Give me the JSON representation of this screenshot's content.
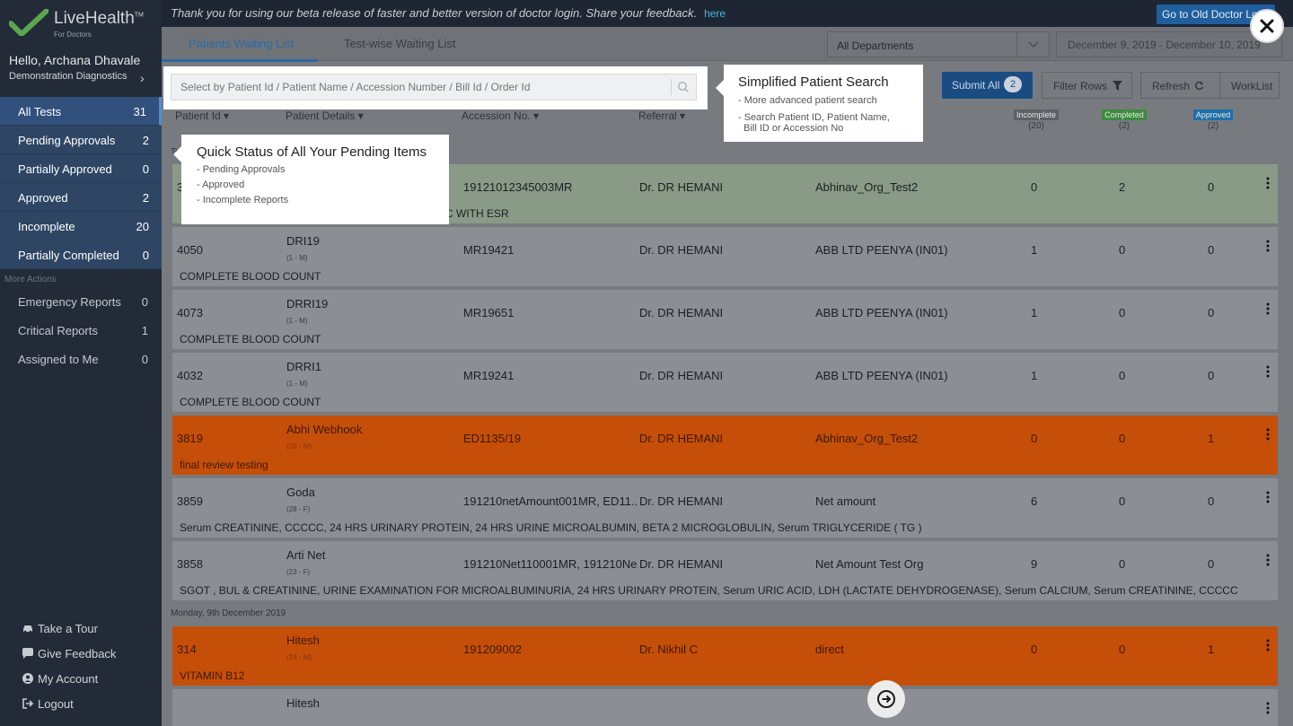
{
  "brand": {
    "name": "LiveHealth",
    "tagline": "For Doctors",
    "tm": "TM"
  },
  "user": {
    "greeting": "Hello, Archana Dhavale",
    "org": "Demonstration Diagnostics"
  },
  "nav": [
    {
      "label": "All Tests",
      "count": "31"
    },
    {
      "label": "Pending Approvals",
      "count": "2"
    },
    {
      "label": "Partially Approved",
      "count": "0"
    },
    {
      "label": "Approved",
      "count": "2"
    },
    {
      "label": "Incomplete",
      "count": "20"
    },
    {
      "label": "Partially Completed",
      "count": "0"
    }
  ],
  "more_actions_label": "More Actions",
  "more_nav": [
    {
      "label": "Emergency Reports",
      "count": "0"
    },
    {
      "label": "Critical Reports",
      "count": "1"
    },
    {
      "label": "Assigned to Me",
      "count": "0"
    }
  ],
  "bottom_links": [
    {
      "label": "Take a Tour",
      "icon": "car-icon"
    },
    {
      "label": "Give Feedback",
      "icon": "chat-icon"
    },
    {
      "label": "My Account",
      "icon": "user-circle-icon"
    },
    {
      "label": "Logout",
      "icon": "logout-icon"
    }
  ],
  "banner": {
    "text": "Thank you for using our beta release of faster and better version of doctor login. Share your feedback.",
    "link": "here",
    "old_login": "Go to Old Doctor Login"
  },
  "tabs": [
    "Patients Waiting List",
    "Test-wise Waiting List"
  ],
  "department": "All Departments",
  "date_range": "December 9, 2019 - December 10, 2019",
  "search": {
    "placeholder": "Select by Patient Id / Patient Name / Accession Number / Bill Id / Order Id"
  },
  "toolbar": {
    "submit": "Submit All",
    "submit_count": "2",
    "filter": "Filter Rows",
    "refresh": "Refresh",
    "worklist": "WorkList"
  },
  "columns": {
    "patient_id": "Patient Id",
    "patient_details": "Patient Details",
    "accession": "Accession No.",
    "referral": "Referral"
  },
  "stats": {
    "incomplete": {
      "label": "Incomplete",
      "count": "(20)"
    },
    "completed": {
      "label": "Completed",
      "count": "(2)"
    },
    "approved": {
      "label": "Approved",
      "count": "(2)"
    }
  },
  "rows": [
    {
      "id": "3",
      "name": "",
      "age": "",
      "accession": "19121012345003MR",
      "referral": "Dr. DR HEMANI",
      "org": "Abhinav_Org_Test2",
      "inc": "0",
      "comp": "2",
      "appr": "0",
      "tests": "BC WITH ESR",
      "style": "green"
    },
    {
      "id": "4050",
      "name": "DRI19",
      "age": "(1 - M)",
      "accession": "MR19421",
      "referral": "Dr. DR HEMANI",
      "org": "ABB LTD PEENYA (IN01)",
      "inc": "1",
      "comp": "0",
      "appr": "0",
      "tests": "COMPLETE BLOOD COUNT",
      "style": "grey"
    },
    {
      "id": "4073",
      "name": "DRRI19",
      "age": "(1 - M)",
      "accession": "MR19651",
      "referral": "Dr. DR HEMANI",
      "org": "ABB LTD PEENYA (IN01)",
      "inc": "1",
      "comp": "0",
      "appr": "0",
      "tests": "COMPLETE BLOOD COUNT",
      "style": "grey"
    },
    {
      "id": "4032",
      "name": "DRRI1",
      "age": "(1 - M)",
      "accession": "MR19241",
      "referral": "Dr. DR HEMANI",
      "org": "ABB LTD PEENYA (IN01)",
      "inc": "1",
      "comp": "0",
      "appr": "0",
      "tests": "COMPLETE BLOOD COUNT",
      "style": "grey"
    },
    {
      "id": "3819",
      "name": "Abhi Webhook",
      "age": "(20 - M)",
      "accession": "ED1135/19",
      "referral": "Dr. DR HEMANI",
      "org": "Abhinav_Org_Test2",
      "inc": "0",
      "comp": "0",
      "appr": "1",
      "tests": "final review testing",
      "style": "orange"
    },
    {
      "id": "3859",
      "name": "Goda",
      "age": "(28 - F)",
      "accession": "191210netAmount001MR, ED11...",
      "referral": "Dr. DR HEMANI",
      "org": "Net amount",
      "inc": "6",
      "comp": "0",
      "appr": "0",
      "tests": "Serum CREATININE, CCCCC, 24 HRS URINARY PROTEIN, 24 HRS URINE MICROALBUMIN, BETA 2 MICROGLOBULIN, Serum TRIGLYCERIDE ( TG )",
      "style": "grey"
    },
    {
      "id": "3858",
      "name": "Arti Net",
      "age": "(23 - F)",
      "accession": "191210Net110001MR, 191210Ne...",
      "referral": "Dr. DR HEMANI",
      "org": "Net Amount Test Org",
      "inc": "9",
      "comp": "0",
      "appr": "0",
      "tests": "SGOT , BUL & CREATININE, URINE EXAMINATION FOR MICROALBUMINURIA, 24 HRS URINARY PROTEIN, Serum URIC ACID, LDH (LACTATE DEHYDROGENASE), Serum CALCIUM, Serum CREATININE, CCCCC",
      "style": "grey"
    },
    {
      "id": "314",
      "name": "Hitesh",
      "age": "(24 - M)",
      "accession": "191209002",
      "referral": "Dr. Nikhil C",
      "org": "direct",
      "inc": "0",
      "comp": "0",
      "appr": "1",
      "tests": "VITAMIN B12",
      "style": "orange"
    },
    {
      "id": "",
      "name": "Hitesh",
      "age": "",
      "accession": "",
      "referral": "",
      "org": "",
      "inc": "",
      "comp": "",
      "appr": "",
      "tests": "",
      "style": "grey"
    }
  ],
  "date_labels": {
    "first": "To",
    "second": "Monday, 9th December 2019"
  },
  "tour_search": {
    "title": "Simplified Patient Search",
    "lines": [
      "- More advanced patient search",
      "- Search Patient ID, Patient Name,",
      "  Bill ID or Accession No"
    ]
  },
  "tour_status": {
    "title": "Quick Status of All Your Pending Items",
    "lines": [
      "- Pending Approvals",
      "- Approved",
      "- Incomplete Reports"
    ]
  },
  "colors": {
    "accent": "#2c6aa3",
    "orange_row": "#c54e09",
    "green_row": "#899a86",
    "badge_incomplete": "#5d6064",
    "badge_completed": "#3f8a3f",
    "badge_approved": "#1c6fa8"
  }
}
